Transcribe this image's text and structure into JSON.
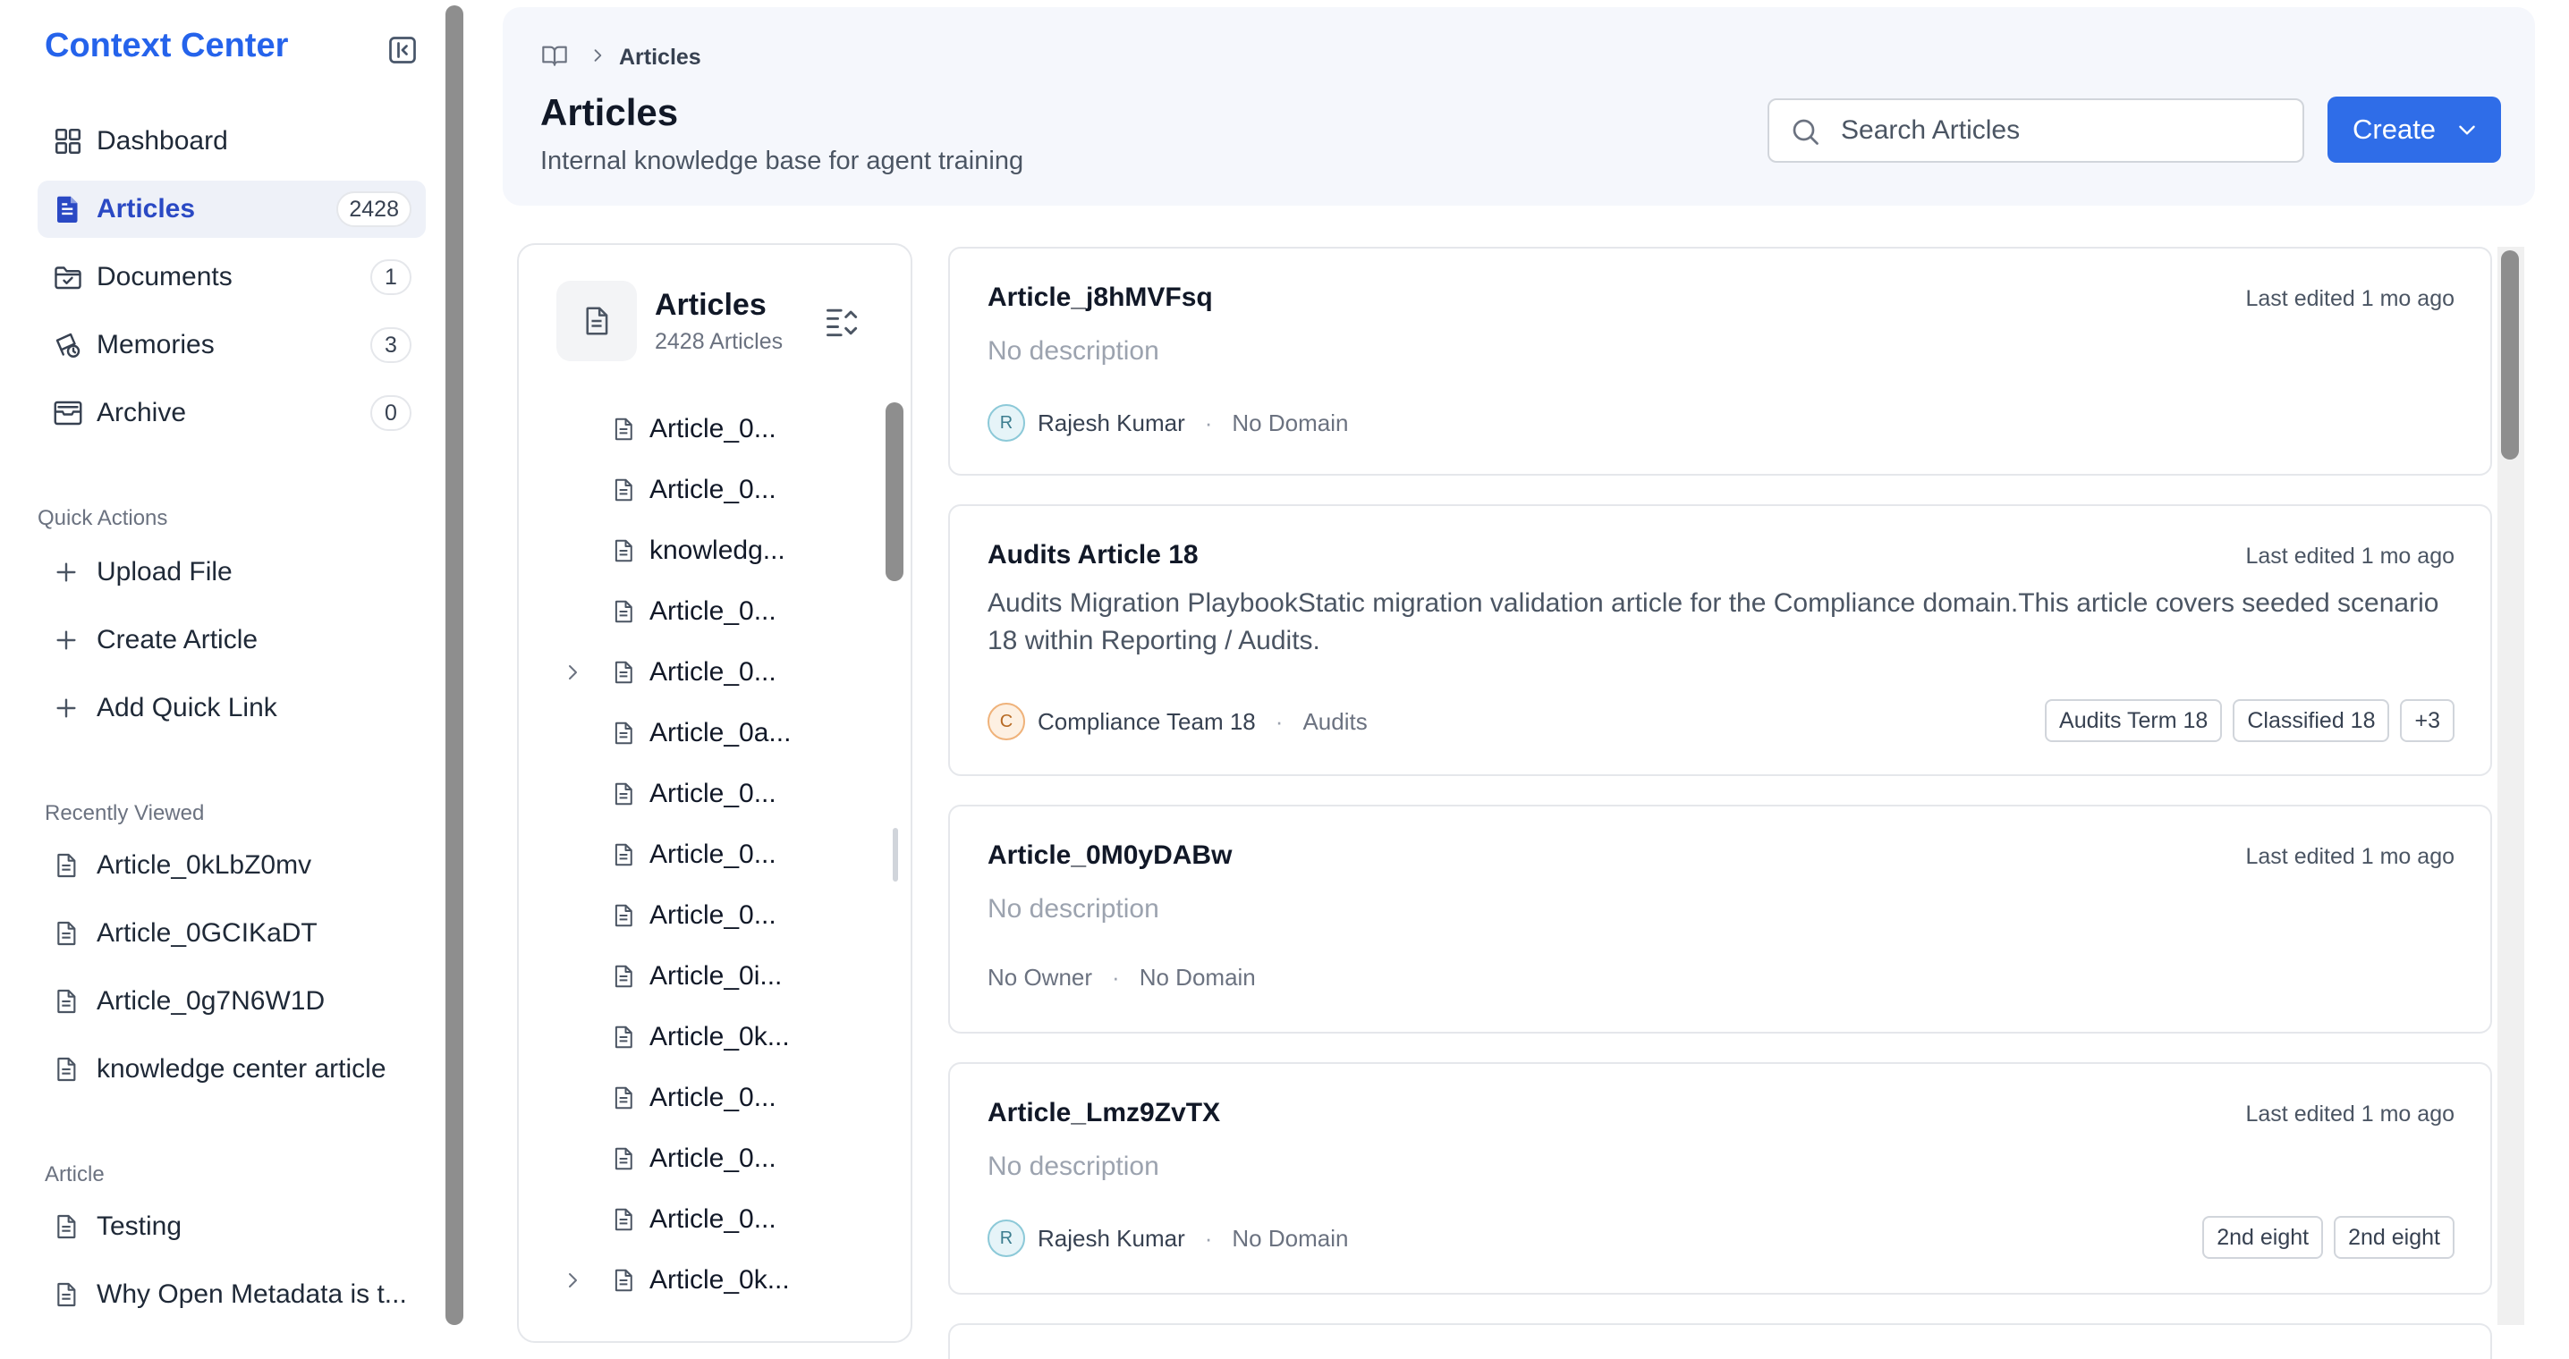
{
  "sidebar": {
    "brand": "Context Center",
    "nav": [
      {
        "label": "Dashboard",
        "icon": "grid-icon",
        "badge": null,
        "active": false
      },
      {
        "label": "Articles",
        "icon": "article-icon",
        "badge": "2428",
        "active": true
      },
      {
        "label": "Documents",
        "icon": "folder-check-icon",
        "badge": "1",
        "active": false
      },
      {
        "label": "Memories",
        "icon": "memories-icon",
        "badge": "3",
        "active": false
      },
      {
        "label": "Archive",
        "icon": "archive-icon",
        "badge": "0",
        "active": false
      }
    ],
    "quick_actions_title": "Quick Actions",
    "quick_actions": [
      "Upload File",
      "Create Article",
      "Add Quick Link"
    ],
    "recently_viewed_title": "Recently Viewed",
    "recently_viewed": [
      "Article_0kLbZ0mv",
      "Article_0GCIKaDT",
      "Article_0g7N6W1D",
      "knowledge center article"
    ],
    "article_title": "Article",
    "articles": [
      "Testing",
      "Why Open Metadata is t..."
    ]
  },
  "header": {
    "breadcrumb": "Articles",
    "title": "Articles",
    "subtitle": "Internal knowledge base for agent training",
    "search_placeholder": "Search Articles",
    "create_label": "Create"
  },
  "tree": {
    "title": "Articles",
    "count": "2428 Articles",
    "items": [
      {
        "label": "Article_0...",
        "expandable": false
      },
      {
        "label": "Article_0...",
        "expandable": false
      },
      {
        "label": "knowledg...",
        "expandable": false
      },
      {
        "label": "Article_0...",
        "expandable": false
      },
      {
        "label": "Article_0...",
        "expandable": true
      },
      {
        "label": "Article_0a...",
        "expandable": false
      },
      {
        "label": "Article_0...",
        "expandable": false
      },
      {
        "label": "Article_0...",
        "expandable": false
      },
      {
        "label": "Article_0...",
        "expandable": false
      },
      {
        "label": "Article_0i...",
        "expandable": false
      },
      {
        "label": "Article_0k...",
        "expandable": false
      },
      {
        "label": "Article_0...",
        "expandable": false
      },
      {
        "label": "Article_0...",
        "expandable": false
      },
      {
        "label": "Article_0...",
        "expandable": false
      },
      {
        "label": "Article_0k...",
        "expandable": true
      }
    ]
  },
  "cards": [
    {
      "title": "Article_j8hMVFsq",
      "time": "Last edited 1 mo ago",
      "description": "No description",
      "has_description": false,
      "avatar": "R",
      "avatar_style": "r",
      "owner": "Rajesh Kumar",
      "domain": "No Domain",
      "tags": []
    },
    {
      "title": "Audits Article 18",
      "time": "Last edited 1 mo ago",
      "description": "Audits Migration PlaybookStatic migration validation article for the Compliance domain.This article covers seeded scenario 18 within Reporting / Audits.",
      "has_description": true,
      "avatar": "C",
      "avatar_style": "c",
      "owner": "Compliance Team 18",
      "domain": "Audits",
      "tags": [
        "Audits Term 18",
        "Classified 18",
        "+3"
      ]
    },
    {
      "title": "Article_0M0yDABw",
      "time": "Last edited 1 mo ago",
      "description": "No description",
      "has_description": false,
      "avatar": null,
      "avatar_style": null,
      "owner": "No Owner",
      "domain": "No Domain",
      "tags": []
    },
    {
      "title": "Article_Lmz9ZvTX",
      "time": "Last edited 1 mo ago",
      "description": "No description",
      "has_description": false,
      "avatar": "R",
      "avatar_style": "r",
      "owner": "Rajesh Kumar",
      "domain": "No Domain",
      "tags": [
        "2nd eight",
        "2nd eight"
      ]
    }
  ],
  "colors": {
    "brand": "#2563eb",
    "active_nav_bg": "#eef1f8",
    "active_nav_text": "#2a49c4",
    "primary_button": "#2f6de8",
    "header_bg": "#f5f7fc"
  }
}
